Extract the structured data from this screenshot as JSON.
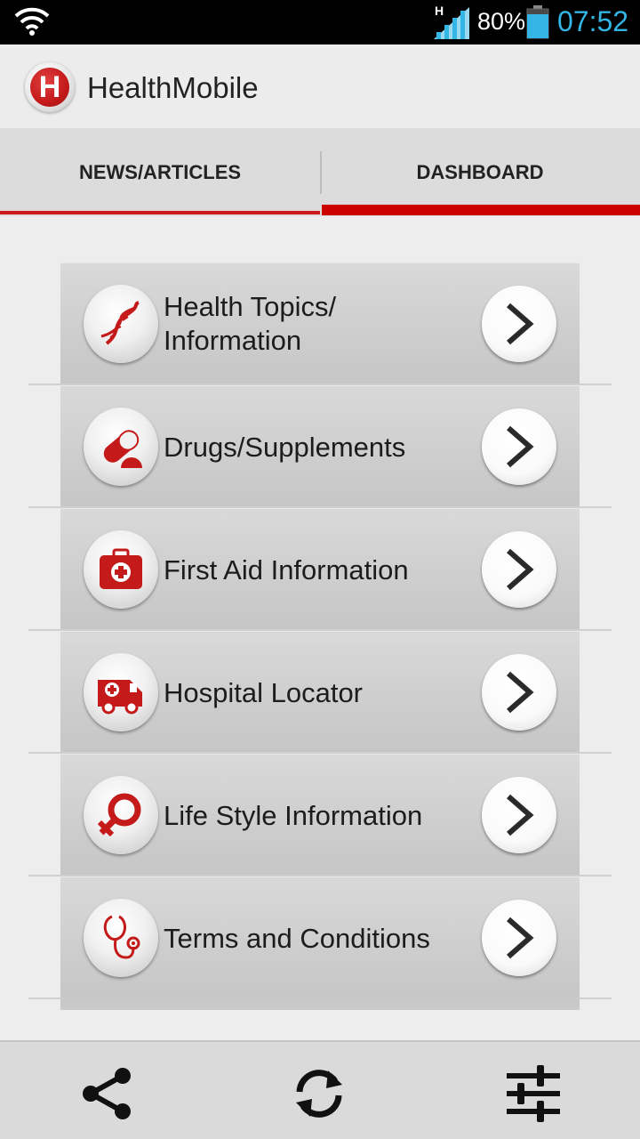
{
  "status_bar": {
    "network_type": "H",
    "battery_percent": "80%",
    "time": "07:52",
    "icons": [
      "wifi-icon",
      "signal-icon",
      "battery-icon"
    ]
  },
  "action_bar": {
    "logo_letter": "H",
    "title": "HealthMobile"
  },
  "tabs": [
    {
      "label": "NEWS/ARTICLES",
      "selected": false
    },
    {
      "label": "DASHBOARD",
      "selected": true
    }
  ],
  "menu": {
    "items": [
      {
        "label": "Health Topics/\nInformation",
        "icon": "dna-icon"
      },
      {
        "label": "Drugs/Supplements",
        "icon": "pill-icon"
      },
      {
        "label": "First Aid Information",
        "icon": "first-aid-kit-icon"
      },
      {
        "label": "Hospital Locator",
        "icon": "ambulance-icon"
      },
      {
        "label": "Life Style Information",
        "icon": "female-symbol-icon"
      },
      {
        "label": "Terms and Conditions",
        "icon": "stethoscope-icon"
      }
    ]
  },
  "bottom_bar": {
    "buttons": [
      "share-icon",
      "refresh-icon",
      "settings-sliders-icon"
    ]
  },
  "colors": {
    "accent": "#cc0000",
    "clock": "#33b5e5",
    "icon_red": "#c41a1a"
  }
}
